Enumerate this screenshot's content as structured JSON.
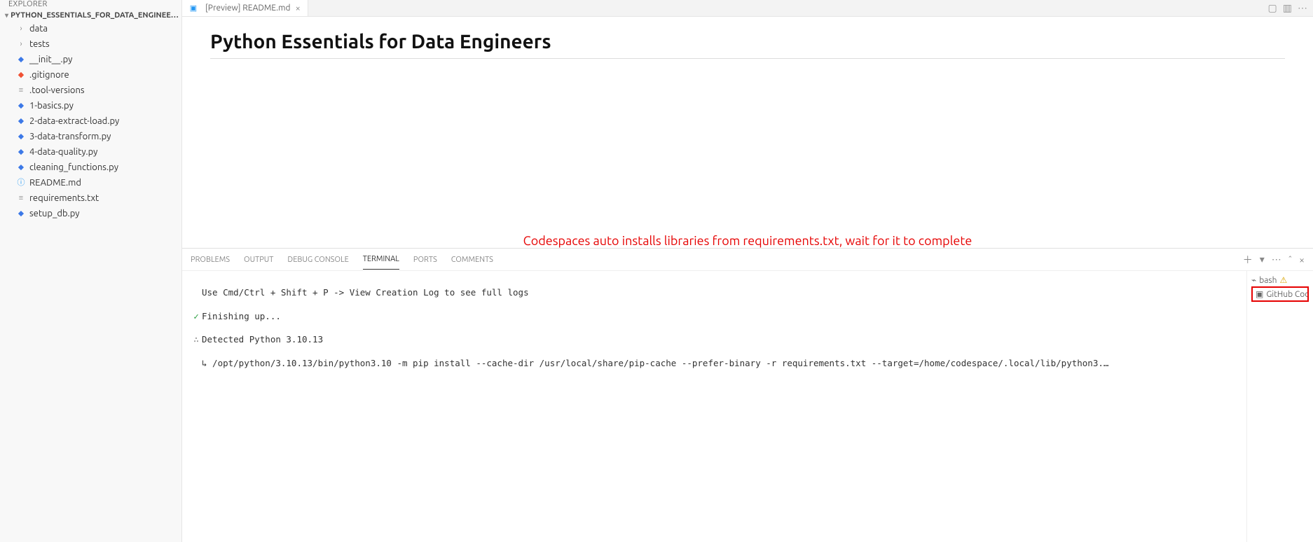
{
  "explorer": {
    "header": "EXPLORER",
    "project": "PYTHON_ESSENTIALS_FOR_DATA_ENGINEERS [CODESP…",
    "items": [
      {
        "kind": "folder",
        "label": "data"
      },
      {
        "kind": "folder",
        "label": "tests"
      },
      {
        "kind": "py",
        "label": "__init__.py"
      },
      {
        "kind": "git",
        "label": ".gitignore"
      },
      {
        "kind": "txt",
        "label": ".tool-versions"
      },
      {
        "kind": "py",
        "label": "1-basics.py"
      },
      {
        "kind": "py",
        "label": "2-data-extract-load.py"
      },
      {
        "kind": "py",
        "label": "3-data-transform.py"
      },
      {
        "kind": "py",
        "label": "4-data-quality.py"
      },
      {
        "kind": "py",
        "label": "cleaning_functions.py"
      },
      {
        "kind": "info",
        "label": "README.md"
      },
      {
        "kind": "txt",
        "label": "requirements.txt"
      },
      {
        "kind": "py",
        "label": "setup_db.py"
      }
    ]
  },
  "tab": {
    "label": "[Preview] README.md"
  },
  "page": {
    "title": "Python Essentials for Data Engineers"
  },
  "annotation": "Codespaces auto installs libraries from requirements.txt, wait for it to complete",
  "panel": {
    "tabs": [
      "PROBLEMS",
      "OUTPUT",
      "DEBUG CONSOLE",
      "TERMINAL",
      "PORTS",
      "COMMENTS"
    ],
    "active": 3,
    "side": {
      "bash": "bash",
      "codespaces": "GitHub Cod…"
    },
    "terminal": {
      "line1": "Use Cmd/Ctrl + Shift + P -> View Creation Log to see full logs",
      "line2": "Finishing up...",
      "line3": "Detected Python 3.10.13",
      "line4": "↳ /opt/python/3.10.13/bin/python3.10 -m pip install --cache-dir /usr/local/share/pip-cache --prefer-binary -r requirements.txt --target=/home/codespace/.local/lib/python3.…"
    }
  }
}
